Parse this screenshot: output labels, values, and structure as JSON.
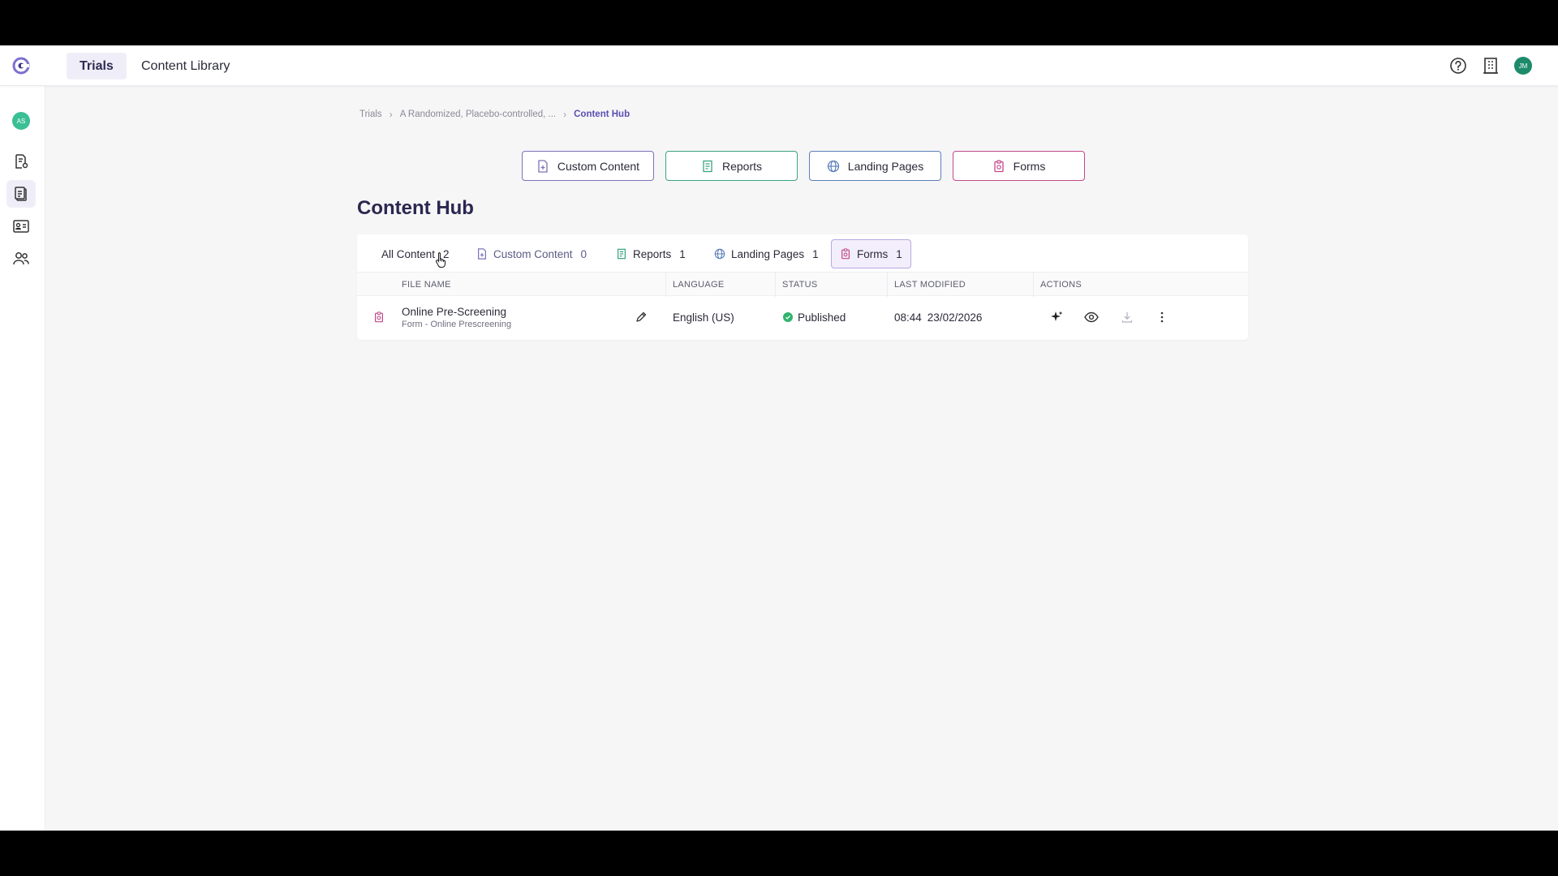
{
  "topbar": {
    "tabs": [
      {
        "label": "Trials",
        "active": true
      },
      {
        "label": "Content Library",
        "active": false
      }
    ],
    "user_initials": "JM",
    "icons": [
      "help-circle-icon",
      "building-icon"
    ]
  },
  "rail": {
    "avatar_initials": "AS",
    "items": [
      "document-settings-icon",
      "clipboard-icon",
      "id-card-icon",
      "users-icon"
    ]
  },
  "breadcrumb": {
    "items": [
      "Trials",
      "A Randomized, Placebo-controlled, ..."
    ],
    "current": "Content Hub"
  },
  "create_buttons": [
    {
      "label": "Custom Content",
      "color": "#7b73b8"
    },
    {
      "label": "Reports",
      "color": "#3ba47f"
    },
    {
      "label": "Landing Pages",
      "color": "#5b7fb8"
    },
    {
      "label": "Forms",
      "color": "#c2488a"
    }
  ],
  "page_title": "Content Hub",
  "filters": [
    {
      "label": "All Content",
      "count": "2"
    },
    {
      "label": "Custom Content",
      "count": "0"
    },
    {
      "label": "Reports",
      "count": "1"
    },
    {
      "label": "Landing Pages",
      "count": "1"
    },
    {
      "label": "Forms",
      "count": "1",
      "active": true
    }
  ],
  "table": {
    "columns": [
      "FILE NAME",
      "LANGUAGE",
      "STATUS",
      "LAST MODIFIED",
      "ACTIONS"
    ],
    "rows": [
      {
        "name": "Online Pre-Screening",
        "subtitle": "Form - Online Prescreening",
        "language": "English (US)",
        "status": "Published",
        "time": "08:44",
        "date": "23/02/2026"
      }
    ]
  },
  "colors": {
    "accent": "#5a4fb0",
    "published": "#2fb46e"
  }
}
